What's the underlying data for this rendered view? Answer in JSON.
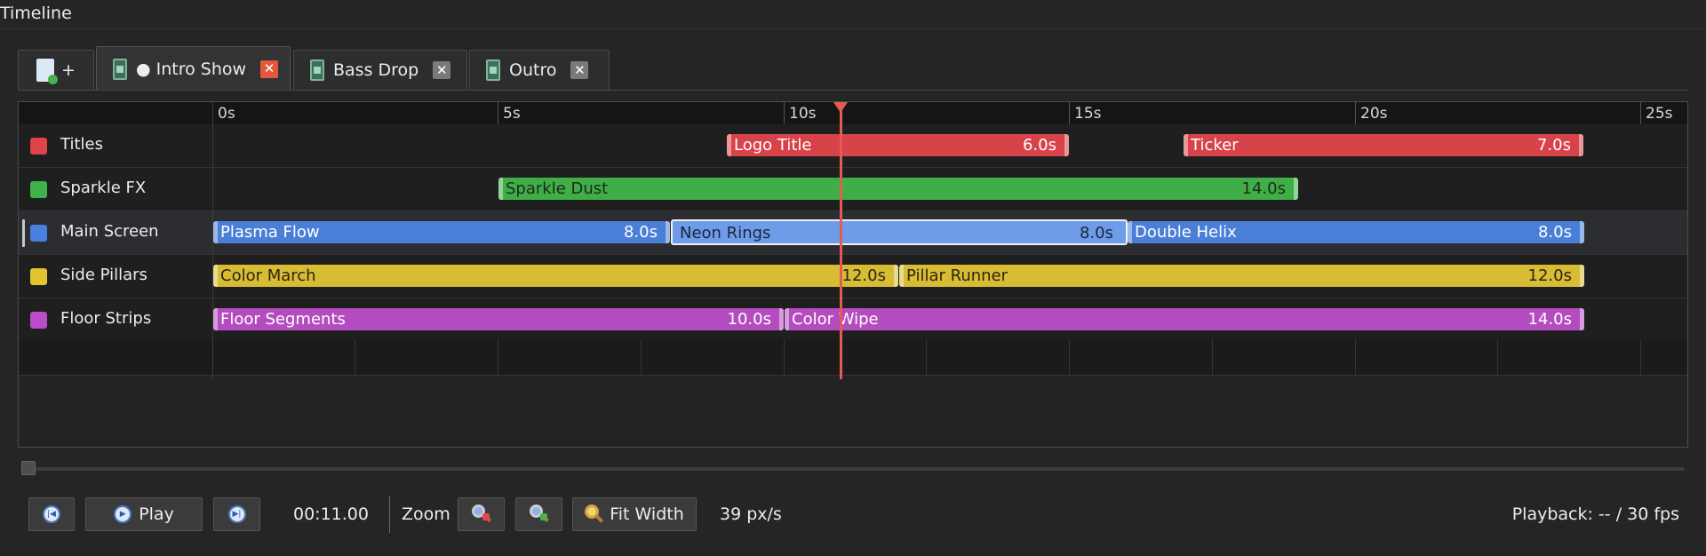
{
  "panel": {
    "title": "Timeline"
  },
  "tabs": {
    "new_tab_label": "+",
    "items": [
      {
        "label": "● Intro Show",
        "active": true
      },
      {
        "label": "Bass Drop",
        "active": false
      },
      {
        "label": "Outro",
        "active": false
      }
    ],
    "close_glyph": "✕"
  },
  "ruler": {
    "labels": [
      "0s",
      "5s",
      "10s",
      "15s",
      "20s",
      "25s"
    ]
  },
  "tracks": [
    {
      "name": "Titles",
      "color": "#e0434a",
      "clips": [
        {
          "name": "Logo Title",
          "duration": "6.0s"
        },
        {
          "name": "Ticker",
          "duration": "7.0s"
        }
      ]
    },
    {
      "name": "Sparkle FX",
      "color": "#3fb24a",
      "clips": [
        {
          "name": "Sparkle Dust",
          "duration": "14.0s"
        }
      ]
    },
    {
      "name": "Main Screen",
      "color": "#4a7fe0",
      "selected": true,
      "clips": [
        {
          "name": "Plasma Flow",
          "duration": "8.0s"
        },
        {
          "name": "Neon Rings",
          "duration": "8.0s",
          "selected": true
        },
        {
          "name": "Double Helix",
          "duration": "8.0s"
        }
      ]
    },
    {
      "name": "Side Pillars",
      "color": "#e2c430",
      "clips": [
        {
          "name": "Color March",
          "duration": "12.0s"
        },
        {
          "name": "Pillar Runner",
          "duration": "12.0s"
        }
      ]
    },
    {
      "name": "Floor Strips",
      "color": "#bc4cc8",
      "clips": [
        {
          "name": "Floor Segments",
          "duration": "10.0s"
        },
        {
          "name": "Color Wipe",
          "duration": "14.0s"
        }
      ]
    }
  ],
  "transport": {
    "play_label": "Play",
    "time": "00:11.00",
    "zoom_label": "Zoom",
    "fit_label": "Fit Width",
    "scale": "39 px/s",
    "playback": "Playback: -- / 30 fps"
  },
  "icons": {
    "new_tab": "new-document-icon",
    "tab": "film-strip-icon",
    "skip_start": "skip-to-start-icon",
    "play": "play-icon",
    "skip_end": "skip-to-end-icon",
    "zoom_out": "zoom-out-icon",
    "zoom_in": "zoom-in-icon",
    "fit": "magnifier-icon"
  },
  "colors": {
    "playhead": "#e55a55",
    "accent_close": "#e4573c"
  }
}
